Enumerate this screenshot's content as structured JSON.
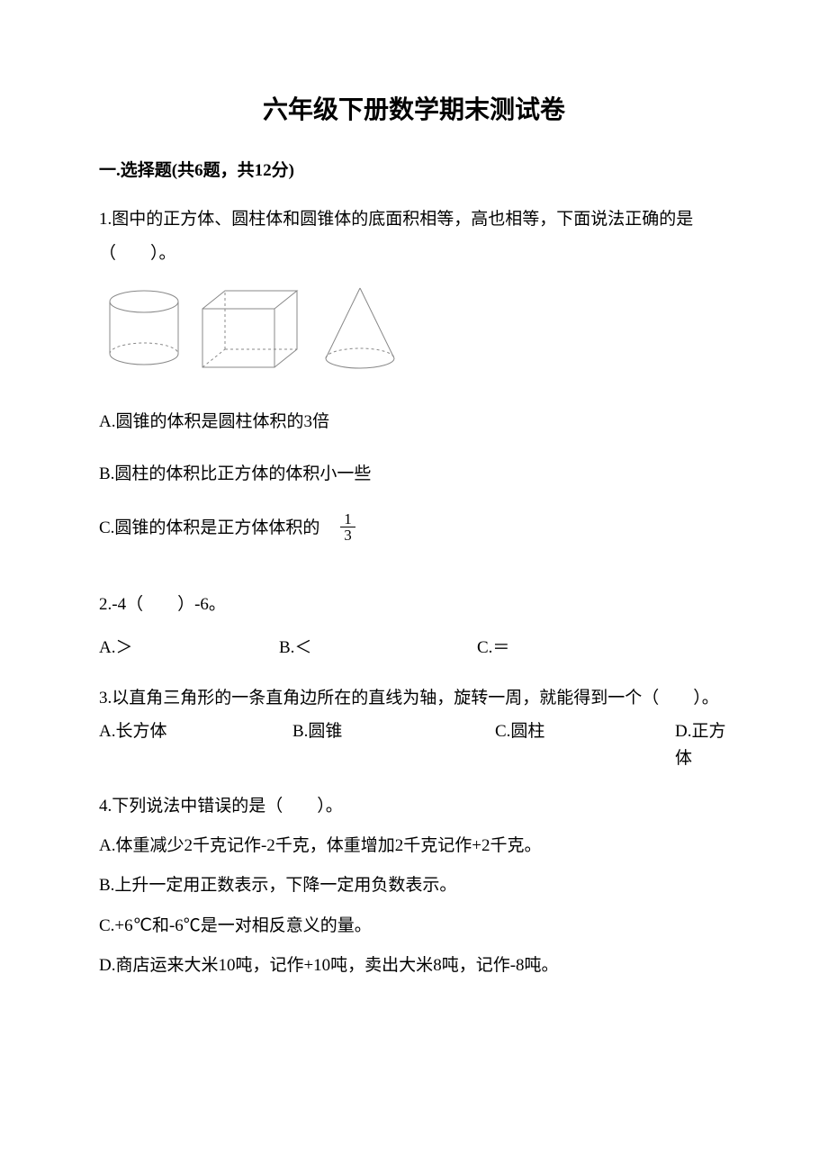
{
  "title": "六年级下册数学期末测试卷",
  "section1": {
    "header": "一.选择题(共6题，共12分)",
    "q1": {
      "text": "1.图中的正方体、圆柱体和圆锥体的底面积相等，高也相等，下面说法正确的是（　　）。",
      "optA": "A.圆锥的体积是圆柱体积的3倍",
      "optB": "B.圆柱的体积比正方体的体积小一些",
      "optC_prefix": "C.圆锥的体积是正方体体积的",
      "frac_num": "1",
      "frac_den": "3"
    },
    "q2": {
      "text": "2.-4（　　）-6。",
      "optA": "A.＞",
      "optB": "B.＜",
      "optC": "C.＝"
    },
    "q3": {
      "text": "3.以直角三角形的一条直角边所在的直线为轴，旋转一周，就能得到一个（　　）。",
      "optA": "A.长方体",
      "optB": "B.圆锥",
      "optC": "C.圆柱",
      "optD": "D.正方体"
    },
    "q4": {
      "text": "4.下列说法中错误的是（　　）。",
      "optA": "A.体重减少2千克记作-2千克，体重增加2千克记作+2千克。",
      "optB": "B.上升一定用正数表示，下降一定用负数表示。",
      "optC": "C.+6℃和-6℃是一对相反意义的量。",
      "optD": "D.商店运来大米10吨，记作+10吨，卖出大米8吨，记作-8吨。"
    }
  }
}
